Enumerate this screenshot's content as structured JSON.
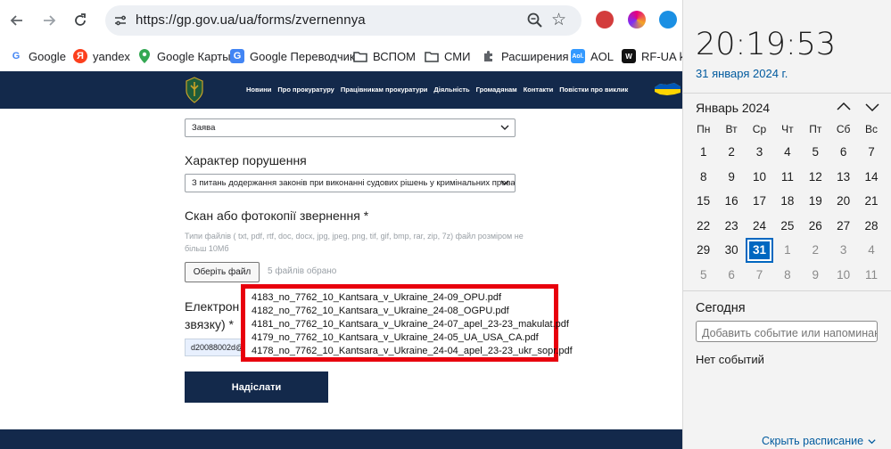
{
  "browser": {
    "url": "https://gp.gov.ua/ua/forms/zvernennya",
    "bookmarks": [
      {
        "label": "Google",
        "icon": "google-icon"
      },
      {
        "label": "yandex",
        "icon": "yandex-icon"
      },
      {
        "label": "Google Карты",
        "icon": "maps-pin-icon"
      },
      {
        "label": "Google Переводчик",
        "icon": "translate-icon"
      },
      {
        "label": "ВСПОМ",
        "icon": "folder-icon"
      },
      {
        "label": "СМИ",
        "icon": "folder-icon"
      },
      {
        "label": "Расширения",
        "icon": "puzzle-icon"
      },
      {
        "label": "AOL",
        "icon": "aol-icon"
      },
      {
        "label": "RF-UA kla",
        "icon": "rfua-icon"
      }
    ]
  },
  "site": {
    "nav": [
      "Новини",
      "Про прокуратуру",
      "Працівникам прокуратури",
      "Діяльність",
      "Громадянам",
      "Контакти",
      "Повістки про виклик"
    ]
  },
  "form": {
    "type_value": "Заява",
    "violation_label": "Характер порушення",
    "violation_value": "З питань додержання законів при виконанні судових рішень у кримінальних провадже",
    "scan_label": "Скан або фотокопії звернення *",
    "hint": "Типи файлів ( txt, pdf, rtf, doc, docx, jpg, jpeg, png, tif, gif, bmp, rar, zip, 7z) файл розміром не більш 10Мб",
    "choose_file": "Оберіть файл",
    "file_count": "5 файлів обрано",
    "email_label_1": "Електрон",
    "email_label_2": "звязку) *",
    "email_value": "d20088002d@",
    "submit": "Надіслати"
  },
  "tooltip_files": [
    "4183_no_7762_10_Kantsara_v_Ukraine_24-09_OPU.pdf",
    "4182_no_7762_10_Kantsara_v_Ukraine_24-08_OGPU.pdf",
    "4181_no_7762_10_Kantsara_v_Ukraine_24-07_apel_23-23_makulat.pdf",
    "4179_no_7762_10_Kantsara_v_Ukraine_24-05_UA_USA_CA.pdf",
    "4178_no_7762_10_Kantsara_v_Ukraine_24-04_apel_23-23_ukr_sopr.pdf"
  ],
  "calendar": {
    "time": "20:19:53",
    "date": "31 января 2024 г.",
    "month": "Январь 2024",
    "weekdays": [
      "Пн",
      "Вт",
      "Ср",
      "Чт",
      "Пт",
      "Сб",
      "Вс"
    ],
    "days": [
      [
        "1",
        "2",
        "3",
        "4",
        "5",
        "6",
        "7"
      ],
      [
        "8",
        "9",
        "10",
        "11",
        "12",
        "13",
        "14"
      ],
      [
        "15",
        "16",
        "17",
        "18",
        "19",
        "20",
        "21"
      ],
      [
        "22",
        "23",
        "24",
        "25",
        "26",
        "27",
        "28"
      ],
      [
        "29",
        "30",
        "31",
        "1",
        "2",
        "3",
        "4"
      ],
      [
        "5",
        "6",
        "7",
        "8",
        "9",
        "10",
        "11"
      ]
    ],
    "today": "31",
    "today_title": "Сегодня",
    "event_placeholder": "Добавить событие или напоминание",
    "no_events": "Нет событий",
    "hide_schedule": "Скрыть расписание"
  },
  "colors": {
    "site_navy": "#13294b",
    "highlight_red": "#e8000d",
    "accent_blue": "#0067c0"
  }
}
